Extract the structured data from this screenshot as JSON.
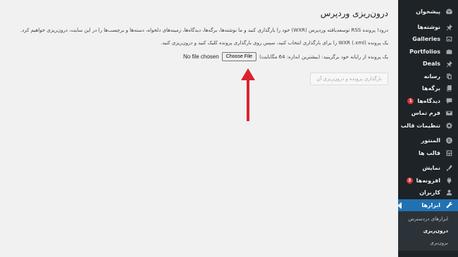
{
  "sidebar": {
    "items": [
      {
        "label": "پیشخوان",
        "icon": "dashboard-icon",
        "badge": ""
      },
      {
        "label": "نوشته‌ها",
        "icon": "pushpin-icon",
        "badge": ""
      },
      {
        "label": "Galleries",
        "icon": "gallery-icon",
        "badge": ""
      },
      {
        "label": "Portfolios",
        "icon": "portfolio-icon",
        "badge": ""
      },
      {
        "label": "Deals",
        "icon": "pushpin-icon",
        "badge": ""
      },
      {
        "label": "رسانه",
        "icon": "media-icon",
        "badge": ""
      },
      {
        "label": "برگه‌ها",
        "icon": "pages-icon",
        "badge": ""
      },
      {
        "label": "دیدگاه‌ها",
        "icon": "comments-icon",
        "badge": "1"
      },
      {
        "label": "فرم تماس",
        "icon": "mail-icon",
        "badge": ""
      },
      {
        "label": "تنظیمات قالب",
        "icon": "gear-icon",
        "badge": ""
      },
      {
        "label": "المنتور",
        "icon": "elementor-icon",
        "badge": ""
      },
      {
        "label": "قالب ها",
        "icon": "templates-icon",
        "badge": ""
      },
      {
        "label": "نمایش",
        "icon": "appearance-icon",
        "badge": ""
      },
      {
        "label": "افزونه‌ها",
        "icon": "plugins-icon",
        "badge": "3"
      },
      {
        "label": "کاربران",
        "icon": "users-icon",
        "badge": ""
      },
      {
        "label": "ابزارها",
        "icon": "wrench-icon",
        "badge": ""
      }
    ],
    "tools_submenu": [
      {
        "label": "ابزارهای دردسترس"
      },
      {
        "label": "درون‌ریزی"
      },
      {
        "label": "برون‌بری"
      }
    ]
  },
  "page": {
    "title": "درون‌ریزی وردپرس",
    "para1": "درود! پرونده RSS توسعه‌یافته وردپرس (WXR) خود را بارگذاری کنید و ما نوشته‌ها، برگه‌ها، دیدگاه‌ها، زمینه‌های دلخواه، دسته‌ها و برچسب‌ها را در این سایت، درون‌ریزی خواهیم کرد.",
    "para2": "یک پرونده WXR (.xml) را برای بارگذاری انتخاب کنید، سپس روی بارگذاری پرونده کلیک کنید و درون‌ریزی کنید.",
    "upload_label": "یک پرونده از رایانه خود برگزینید: (بیشترین اندازه: 64 مگابایت)",
    "choose_file_button": "Choose File",
    "no_file_text": "No file chosen",
    "submit_button": "بارگذاری پرونده و درون‌ریزی آن"
  },
  "colors": {
    "sidebar_bg": "#1d2327",
    "active_blue": "#2271b1",
    "badge_red": "#d63638",
    "arrow_red": "#d9232d"
  }
}
